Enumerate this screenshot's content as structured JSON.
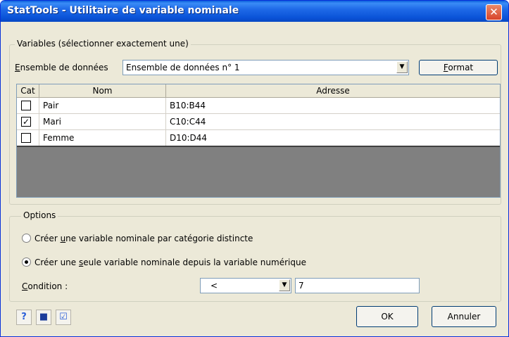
{
  "window": {
    "title": "StatTools - Utilitaire de variable nominale",
    "close_label": "✕"
  },
  "variables_group": {
    "legend": "Variables (sélectionner exactement une)",
    "dataset_label_u": "E",
    "dataset_label_rest": "nsemble de données",
    "dataset_value": "Ensemble de données n° 1",
    "format_u": "F",
    "format_rest": "ormat",
    "columns": [
      "Cat",
      "Nom",
      "Adresse"
    ],
    "rows": [
      {
        "checked": "",
        "name": "Pair",
        "address": "B10:B44"
      },
      {
        "checked": "✓",
        "name": "Mari",
        "address": "C10:C44"
      },
      {
        "checked": "",
        "name": "Femme",
        "address": "D10:D44"
      }
    ]
  },
  "options_group": {
    "legend": "Options",
    "radio1_pre": "Créer ",
    "radio1_u": "u",
    "radio1_post": "ne variable nominale par catégorie distincte",
    "radio2_pre": "Créer une ",
    "radio2_u": "s",
    "radio2_post": "eule variable nominale depuis la variable numérique",
    "radio_selected": "seule",
    "condition_u": "C",
    "condition_rest": "ondition :",
    "operator_value": "<",
    "threshold_value": "7"
  },
  "footer": {
    "ok_label": "OK",
    "cancel_label": "Annuler",
    "help_icon": "help-icon",
    "save_icon": "save-icon",
    "select_icon": "select-check-icon"
  }
}
